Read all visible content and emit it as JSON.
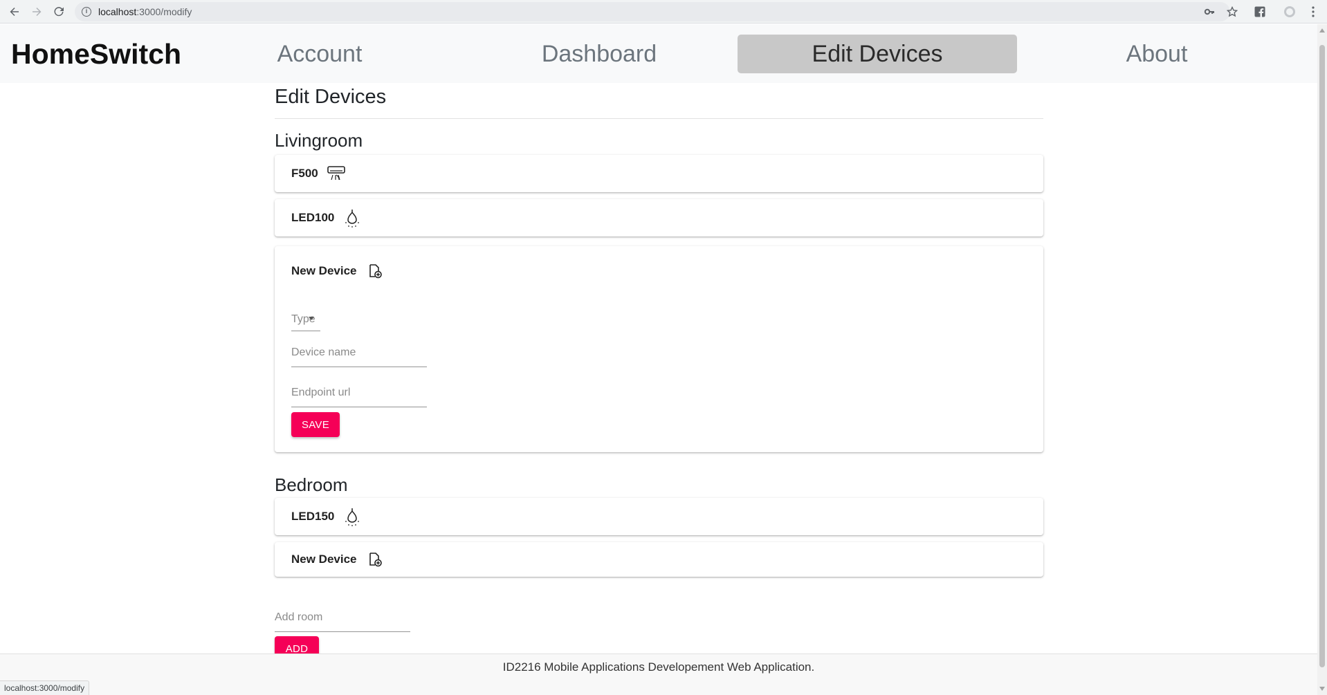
{
  "browser": {
    "url_host": "localhost",
    "url_path": ":3000/modify",
    "status_url": "localhost:3000/modify"
  },
  "header": {
    "brand": "HomeSwitch",
    "nav": [
      "Account",
      "Dashboard",
      "Edit Devices",
      "About"
    ],
    "active_nav": "Edit Devices"
  },
  "main": {
    "title": "Edit Devices",
    "rooms": [
      {
        "name": "Livingroom",
        "devices": [
          {
            "name": "F500",
            "icon": "air-conditioner-icon"
          },
          {
            "name": "LED100",
            "icon": "lightbulb-icon"
          }
        ],
        "new_device": {
          "label": "New Device",
          "icon": "add-device-icon",
          "type_placeholder": "Type",
          "name_placeholder": "Device name",
          "url_placeholder": "Endpoint url",
          "save_label": "SAVE"
        }
      },
      {
        "name": "Bedroom",
        "devices": [
          {
            "name": "LED150",
            "icon": "lightbulb-icon"
          }
        ],
        "new_device": {
          "label": "New Device",
          "icon": "add-device-icon"
        }
      }
    ],
    "add_room": {
      "placeholder": "Add room",
      "button": "ADD"
    }
  },
  "footer": {
    "text": "ID2216 Mobile Applications Developement Web Application."
  },
  "colors": {
    "accent": "#f50057",
    "header_bg": "#f8f9fa",
    "active_nav_bg": "#c8c8c8"
  }
}
